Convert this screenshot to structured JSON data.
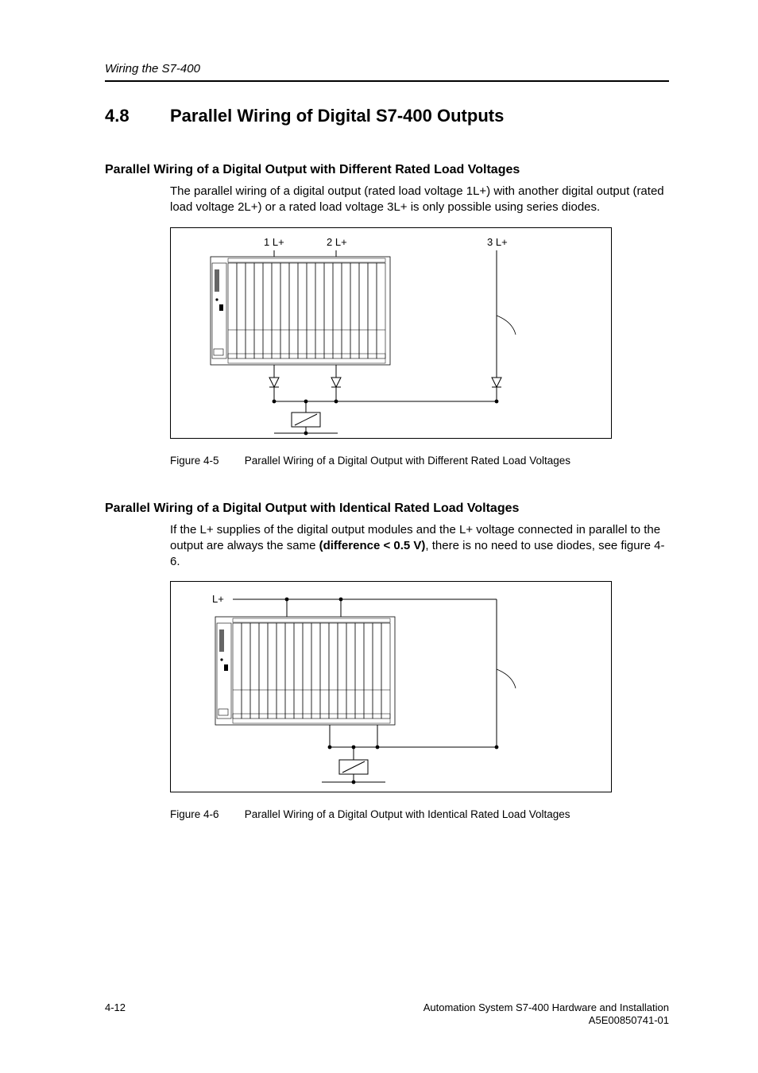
{
  "running_head": "Wiring the S7-400",
  "section": {
    "number": "4.8",
    "title": "Parallel Wiring of Digital S7-400 Outputs"
  },
  "sub1": {
    "heading": "Parallel Wiring of a Digital Output with Different Rated Load Voltages",
    "body": "The parallel wiring of a digital output (rated load voltage 1L+) with another digital output (rated load voltage 2L+) or a rated load voltage 3L+ is only possible using series diodes."
  },
  "fig1": {
    "labels": {
      "l1": "1 L+",
      "l2": "2 L+",
      "l3": "3 L+"
    },
    "number": "Figure 4-5",
    "caption": "Parallel Wiring of a Digital Output with Different Rated Load Voltages"
  },
  "sub2": {
    "heading": "Parallel Wiring of a Digital Output with Identical Rated Load Voltages",
    "body_a": "If the L+ supplies of the digital output modules and the L+ voltage connected in parallel to the output are always the same ",
    "body_bold": "(difference < 0.5 V)",
    "body_b": ", there is no need to use diodes, see figure 4-6."
  },
  "fig2": {
    "labels": {
      "l": "L+"
    },
    "number": "Figure 4-6",
    "caption": "Parallel Wiring of a Digital Output with Identical Rated Load Voltages"
  },
  "footer": {
    "page": "4-12",
    "line1": "Automation System S7-400  Hardware and Installation",
    "line2": "A5E00850741-01"
  }
}
